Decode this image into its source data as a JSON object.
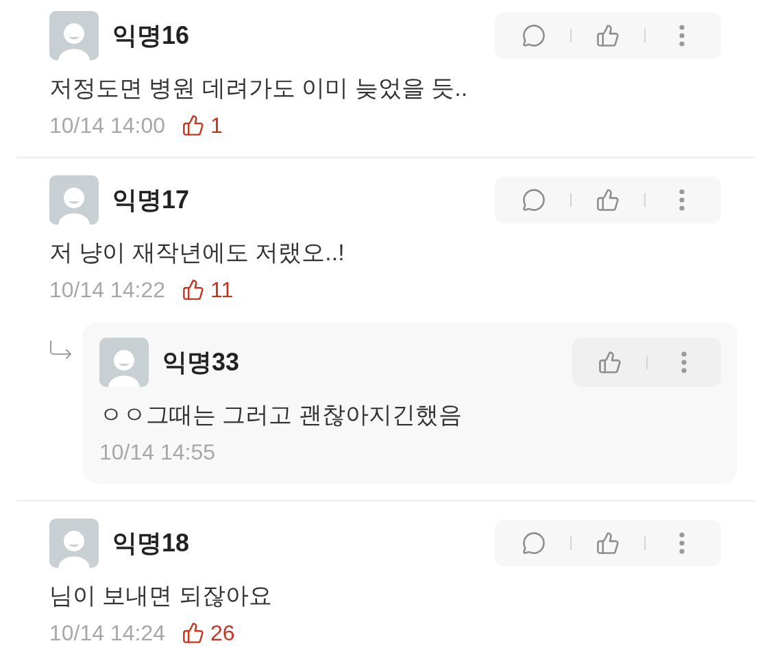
{
  "comments": [
    {
      "author": "익명16",
      "text": "저정도면 병원 데려가도 이미 늦었을 듯..",
      "time": "10/14 14:00",
      "likes": "1"
    },
    {
      "author": "익명17",
      "text": "저 냥이 재작년에도 저랬오..!",
      "time": "10/14 14:22",
      "likes": "11",
      "replies": [
        {
          "author": "익명33",
          "text": "ㅇㅇ그때는 그러고 괜찮아지긴했음",
          "time": "10/14 14:55"
        }
      ]
    },
    {
      "author": "익명18",
      "text": "님이 보내면 되잖아요",
      "time": "10/14 14:24",
      "likes": "26"
    }
  ]
}
